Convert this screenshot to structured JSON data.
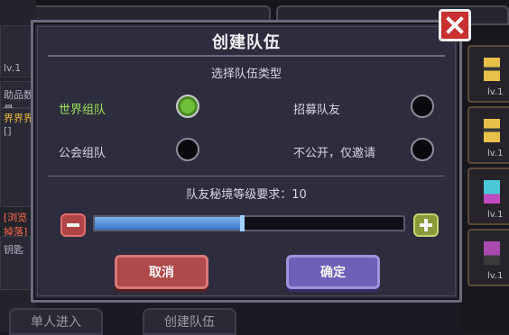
{
  "dialog": {
    "title": "创建队伍",
    "subtitle": "选择队伍类型",
    "options": [
      {
        "label": "世界组队",
        "selected": true
      },
      {
        "label": "招募队友",
        "selected": false
      },
      {
        "label": "公会组队",
        "selected": false
      },
      {
        "label": "不公开，仅邀请",
        "selected": false
      }
    ],
    "level_label": "队友秘境等级要求：10",
    "level_fraction": 0.47,
    "cancel_label": "取消",
    "ok_label": "确定"
  },
  "background": {
    "bottom_buttons": [
      "单人进入",
      "创建队伍"
    ],
    "left_texts": [
      "lv.1",
      "助品数量",
      "界界界",
      "[]",
      "[浏览掉落]",
      "钥匙"
    ],
    "right_slots": [
      "lv.1",
      "lv.1",
      "lv.1",
      "lv.1"
    ]
  },
  "colors": {
    "selected_green": "#6fbf3a",
    "cancel_red": "#b04a4a",
    "confirm_purple": "#6f5fb8",
    "slider_blue": "#3b78c8"
  },
  "icons": {
    "close": "close-icon",
    "minus": "minus-icon",
    "plus": "plus-icon"
  }
}
